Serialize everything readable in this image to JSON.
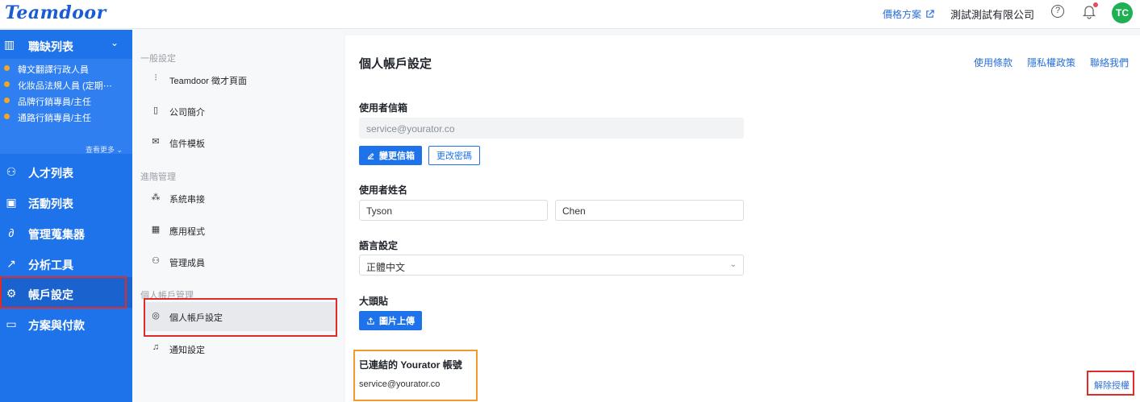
{
  "topbar": {
    "logo": "Teamdoor",
    "pricing_label": "價格方案",
    "company_name": "測試測試有限公司",
    "help_icon": "question-circle-icon",
    "bell_icon": "bell-icon",
    "avatar_initials": "TC",
    "avatar_color": "#1fb055"
  },
  "leftnav": {
    "jobs_header": "職缺列表",
    "jobs": [
      "韓文翻譯行政人員",
      "化妝品法規人員 (定期⋯",
      "品牌行銷專員/主任",
      "通路行銷專員/主任"
    ],
    "see_more": "查看更多",
    "items": [
      {
        "label": "人才列表",
        "icon": "user-icon"
      },
      {
        "label": "活動列表",
        "icon": "calendar-icon"
      },
      {
        "label": "管理蒐集器",
        "icon": "link-icon"
      },
      {
        "label": "分析工具",
        "icon": "trend-icon"
      },
      {
        "label": "帳戶設定",
        "icon": "gear-icon"
      },
      {
        "label": "方案與付款",
        "icon": "card-icon"
      }
    ],
    "accent_color": "#1f73ea"
  },
  "midmenu": {
    "section_general": "一般設定",
    "section_advanced": "進階管理",
    "section_personal": "個人帳戶管理",
    "items": [
      {
        "label": "Teamdoor 徵才頁面",
        "icon": "sliders-icon"
      },
      {
        "label": "公司簡介",
        "icon": "building-icon"
      },
      {
        "label": "信件模板",
        "icon": "mail-icon"
      },
      {
        "label": "系統串接",
        "icon": "nodes-icon"
      },
      {
        "label": "應用程式",
        "icon": "qrcode-icon"
      },
      {
        "label": "管理成員",
        "icon": "users-icon"
      },
      {
        "label": "個人帳戶設定",
        "icon": "user-circle-icon"
      },
      {
        "label": "通知設定",
        "icon": "bell-settings-icon"
      }
    ]
  },
  "main": {
    "title": "個人帳戶設定",
    "links": [
      "使用條款",
      "隱私權政策",
      "聯絡我們"
    ],
    "email_label": "使用者信箱",
    "email_value": "service@yourator.co",
    "change_email_button": "變更信箱",
    "change_password_button": "更改密碼",
    "name_label": "使用者姓名",
    "first_name": "Tyson",
    "last_name": "Chen",
    "language_label": "語言設定",
    "language_value": "正體中文",
    "avatar_label": "大頭貼",
    "upload_button": "圖片上傳",
    "linked_title": "已連結的 Yourator 帳號",
    "linked_email": "service@yourator.co",
    "revoke_label": "解除授權"
  }
}
